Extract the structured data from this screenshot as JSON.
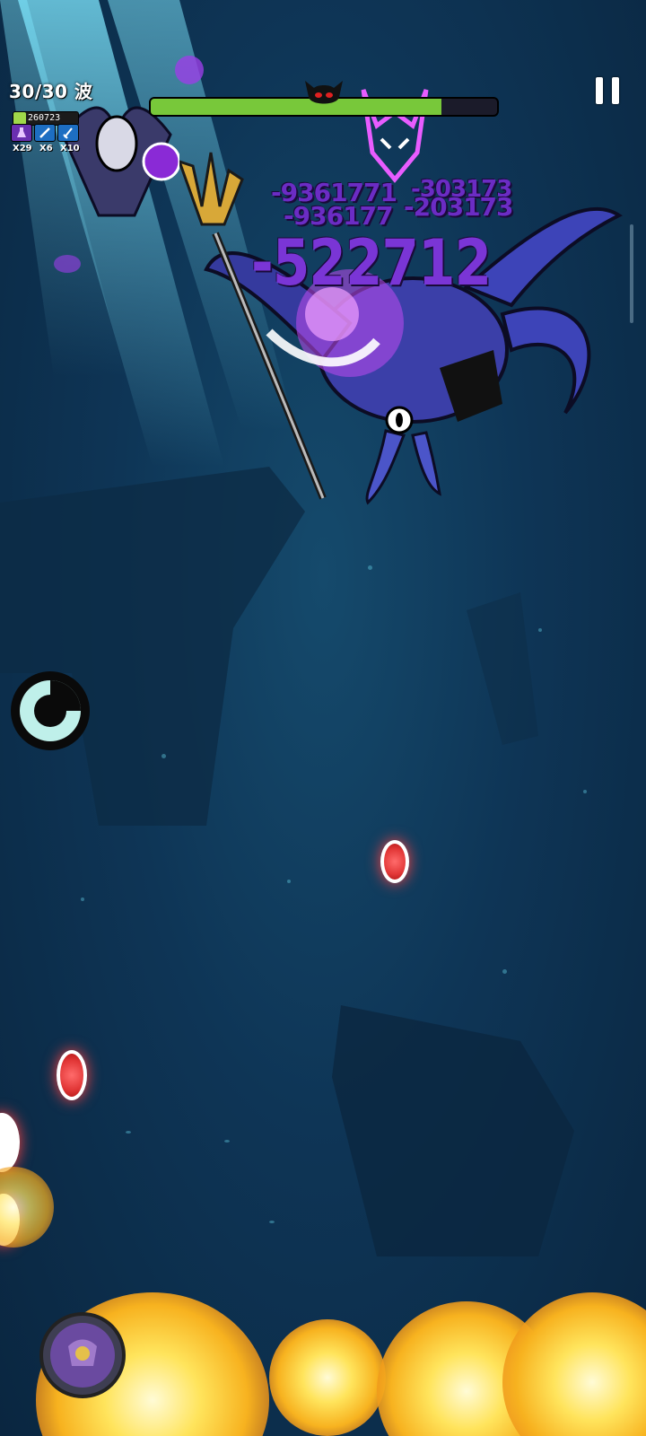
{
  "hud": {
    "wave_label": "30/30 波",
    "hp_value": "260723",
    "hp_fill_fraction": 0.2,
    "items": [
      {
        "icon": "potion-icon",
        "count": "X29"
      },
      {
        "icon": "sword-icon",
        "count": "X6"
      },
      {
        "icon": "dagger-icon",
        "count": "X10"
      }
    ]
  },
  "boss": {
    "icon": "demon-skull-icon",
    "health_fraction": 0.84
  },
  "damage_numbers": {
    "big": "-522712",
    "small_1": "-9361771",
    "small_2": "-303173",
    "small_3": "-936177",
    "small_4": "-203173"
  },
  "colors": {
    "boss_health": "#78c83a",
    "player_health": "#9fd84a",
    "damage_text": "#7a35d6",
    "enemy_orb": "#e23737"
  }
}
